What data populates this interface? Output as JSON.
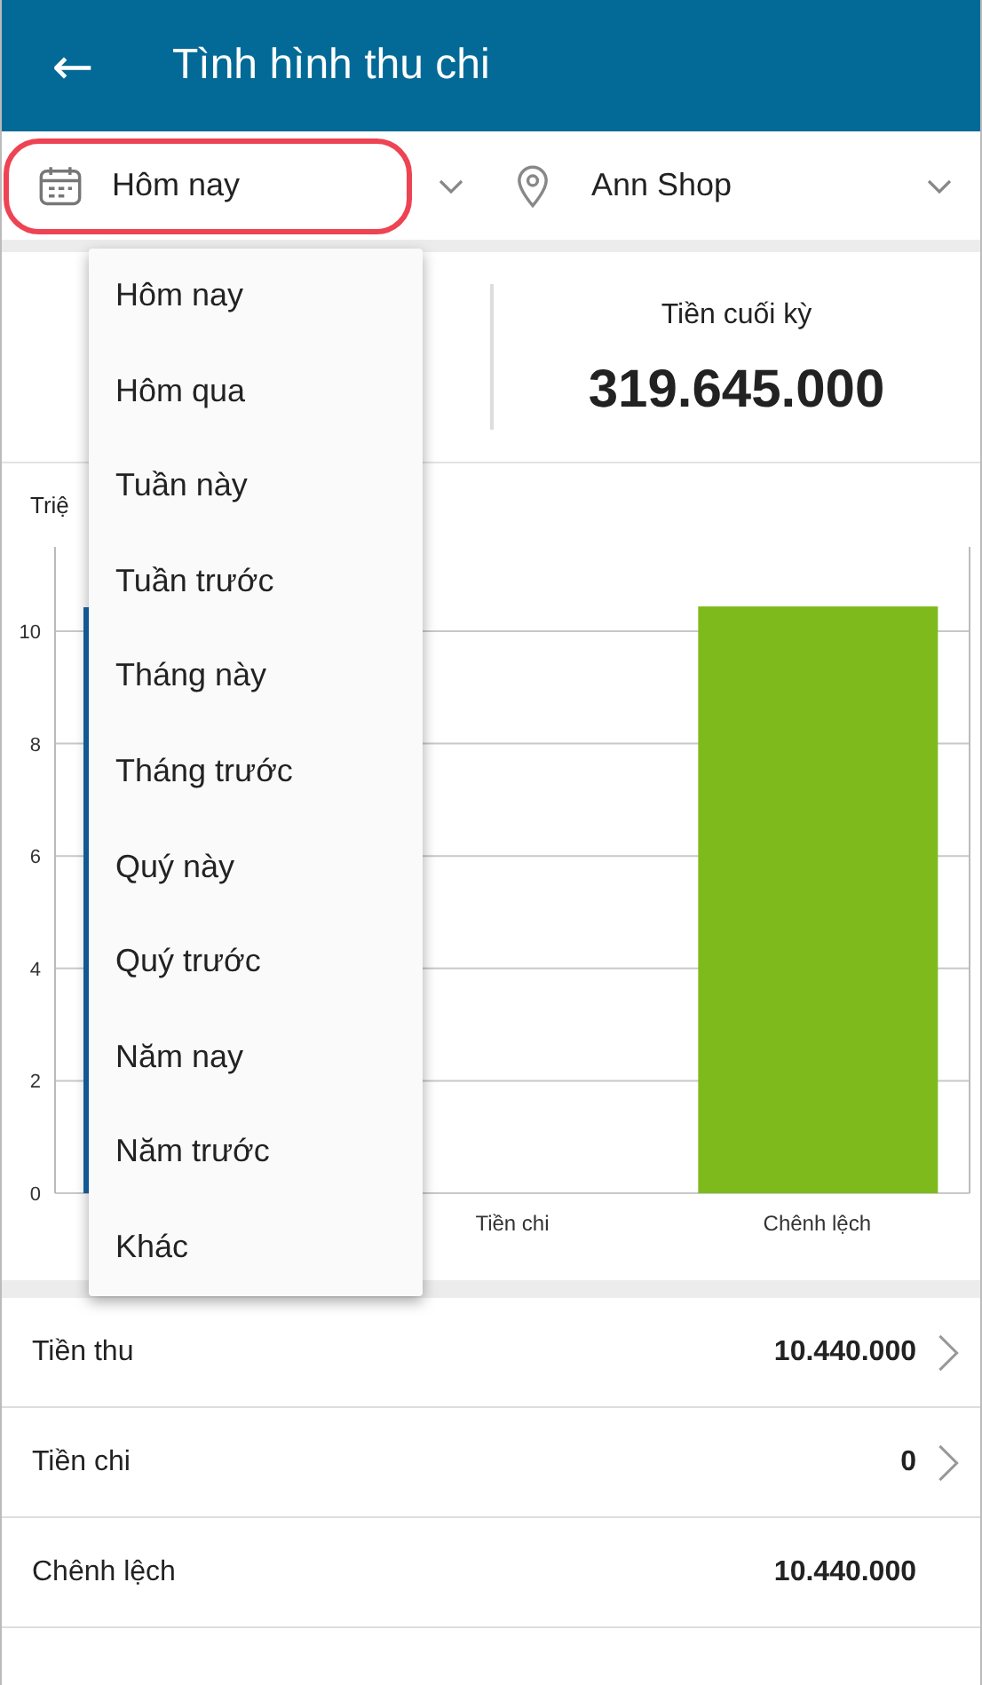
{
  "app_bar": {
    "back": "←",
    "title": "Tình hình thu chi"
  },
  "filters": {
    "period": {
      "value": "Hôm nay",
      "highlighted": true
    },
    "store": {
      "value": "Ann Shop"
    }
  },
  "summary": {
    "label": "Tiền cuối kỳ",
    "value": "319.645.000"
  },
  "chart": {
    "unit_label": "Triệ",
    "chart_data": {
      "type": "bar",
      "categories": [
        null,
        "Tiền chi",
        "Chênh lệch"
      ],
      "values": [
        null,
        0,
        10.44
      ],
      "ylim": [
        0,
        11.5
      ],
      "yticks": [
        0,
        2,
        4,
        6,
        8,
        10
      ],
      "grid": true
    }
  },
  "period_menu": [
    {
      "label": "Hôm nay"
    },
    {
      "label": "Hôm qua"
    },
    {
      "label": "Tuần này"
    },
    {
      "label": "Tuần trước"
    },
    {
      "label": "Tháng này"
    },
    {
      "label": "Tháng trước"
    },
    {
      "label": "Quý này"
    },
    {
      "label": "Quý trước"
    },
    {
      "label": "Năm nay"
    },
    {
      "label": "Năm trước"
    },
    {
      "label": "Khác"
    }
  ],
  "rows": [
    {
      "label": "Tiền thu",
      "value": "10.440.000",
      "has_detail": true
    },
    {
      "label": "Tiền chi",
      "value": "0",
      "has_detail": true
    },
    {
      "label": "Chênh lệch",
      "value": "10.440.000",
      "has_detail": false
    }
  ]
}
